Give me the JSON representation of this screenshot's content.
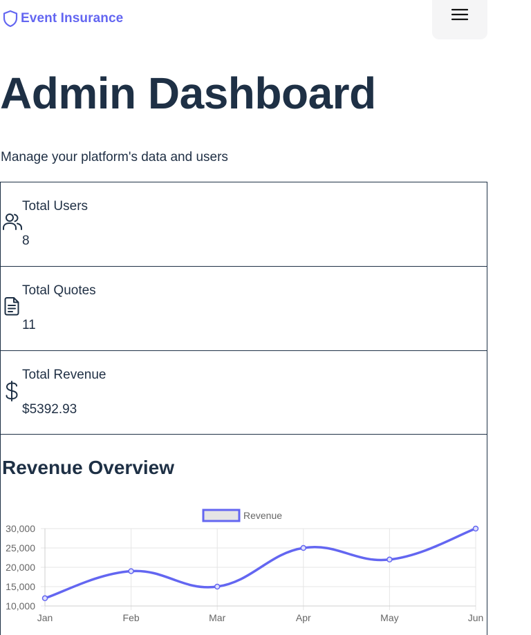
{
  "header": {
    "brand": "Event Insurance",
    "brand_icon": "shield-icon",
    "menu_icon": "hamburger-menu-icon",
    "accent_color": "#6366f1"
  },
  "main": {
    "title": "Admin Dashboard",
    "subtitle": "Manage your platform's data and users"
  },
  "stats": [
    {
      "label": "Total Users",
      "value": "8",
      "icon": "users-icon"
    },
    {
      "label": "Total Quotes",
      "value": "11",
      "icon": "document-icon"
    },
    {
      "label": "Total Revenue",
      "value": "$5392.93",
      "icon": "dollar-icon"
    }
  ],
  "chart_section": {
    "title": "Revenue Overview"
  },
  "chart_data": {
    "type": "line",
    "categories": [
      "Jan",
      "Feb",
      "Mar",
      "Apr",
      "May",
      "Jun"
    ],
    "series": [
      {
        "name": "Revenue",
        "values": [
          12000,
          19000,
          15000,
          25000,
          22000,
          30000
        ],
        "color": "#6366f1"
      }
    ],
    "yticks": [
      10000,
      15000,
      20000,
      25000,
      30000
    ],
    "ytick_labels": [
      "10,000",
      "15,000",
      "20,000",
      "25,000",
      "30,000"
    ],
    "ylim": [
      10000,
      30000
    ],
    "legend": "top-center",
    "grid": true,
    "smooth": true
  }
}
